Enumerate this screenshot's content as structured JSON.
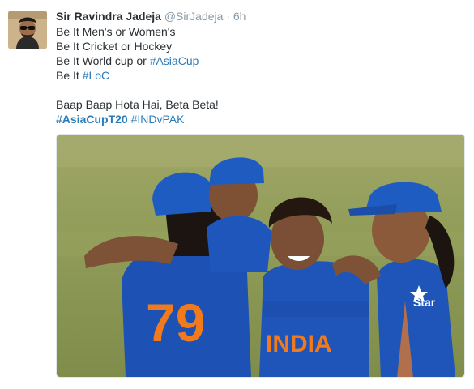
{
  "author": {
    "name": "Sir Ravindra Jadeja",
    "handle": "@SirJadeja",
    "separator": "·",
    "time": "6h"
  },
  "tweet": {
    "lines": [
      "Be It Men's or Women's",
      "Be It Cricket or Hockey"
    ],
    "line3_text": "Be It World cup or ",
    "line3_tag": "#AsiaCup",
    "line4_text": "Be It ",
    "line4_tag": "#LoC",
    "line5_text": "Baap Baap Hota Hai, Beta Beta!",
    "hashtag1": "#AsiaCupT20",
    "hashtag2": "#INDvPAK"
  },
  "media": {
    "jersey_number": "79",
    "jersey_text": "INDIA",
    "sponsor_text": "Star"
  },
  "colors": {
    "link": "#2b7bb9",
    "name": "#292f33",
    "meta": "#8899a6",
    "jersey_blue": "#1f54b8",
    "jersey_orange": "#f07a1c",
    "grass": "#8f9a55"
  }
}
